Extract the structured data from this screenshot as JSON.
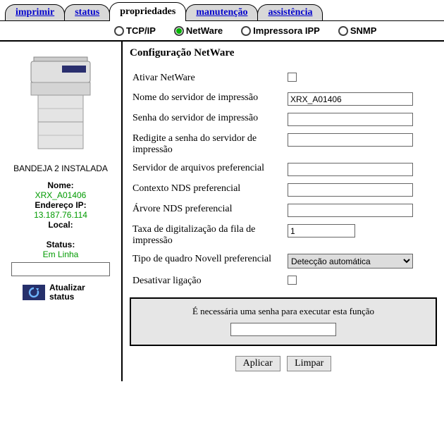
{
  "tabs": {
    "print": "imprimir",
    "status": "status",
    "properties": "propriedades",
    "maintenance": "manutenção",
    "assistance": "assistência"
  },
  "subtabs": {
    "tcpip": "TCP/IP",
    "netware": "NetWare",
    "ipp": "Impressora IPP",
    "snmp": "SNMP"
  },
  "side": {
    "tray_status": "BANDEJA 2 INSTALADA",
    "name_label": "Nome:",
    "name_value": "XRX_A01406",
    "ip_label": "Endereço IP:",
    "ip_value": "13.187.76.114",
    "location_label": "Local:",
    "status_label": "Status:",
    "status_value": "Em Linha",
    "refresh": "Atualizar status"
  },
  "content": {
    "heading": "Configuração NetWare",
    "fields": {
      "enable": "Ativar NetWare",
      "server_name": "Nome do servidor de impressão",
      "server_name_value": "XRX_A01406",
      "password": "Senha do servidor de impressão",
      "password_confirm": "Redigite a senha do servidor de impressão",
      "pref_file_server": "Servidor de arquivos preferencial",
      "pref_nds_context": "Contexto NDS preferencial",
      "pref_nds_tree": "Árvore NDS preferencial",
      "queue_scan_rate": "Taxa de digitalização da fila de impressão",
      "queue_scan_rate_value": "1",
      "frame_type": "Tipo de quadro Novell preferencial",
      "frame_type_value": "Detecção automática",
      "disable_bind": "Desativar ligação"
    },
    "pwbox_text": "É necessária uma senha para executar esta função",
    "apply": "Aplicar",
    "clear": "Limpar"
  }
}
